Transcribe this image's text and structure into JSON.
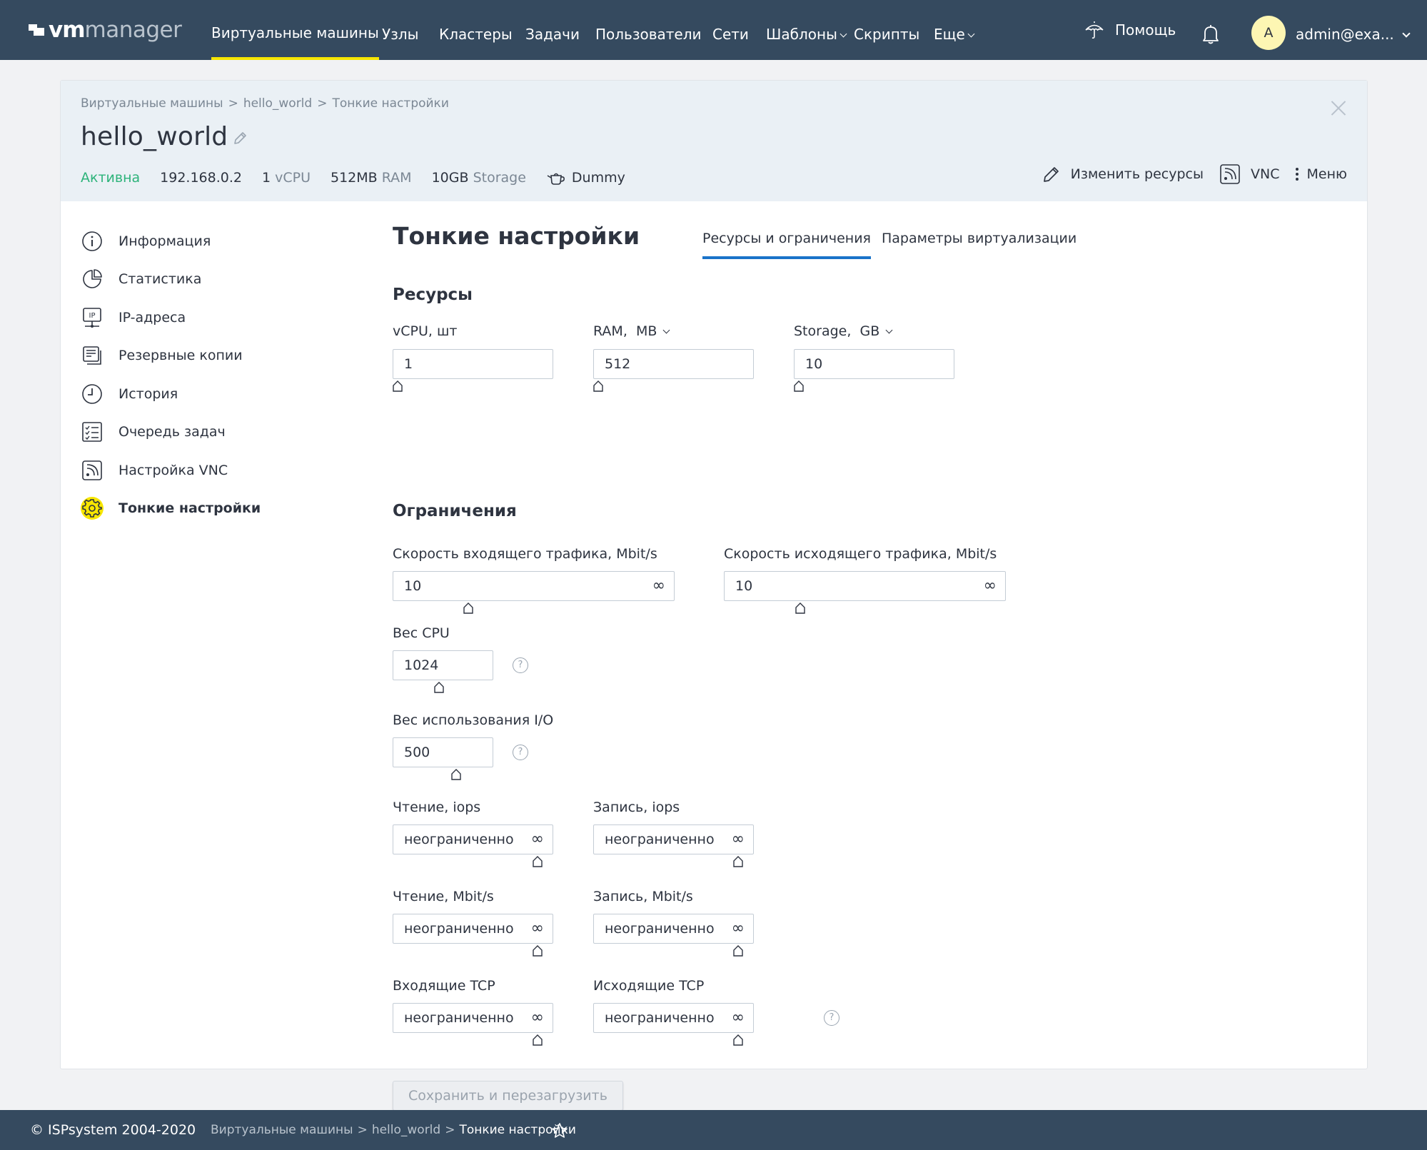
{
  "app": {
    "logo_bold": "vm",
    "logo_light": "manager"
  },
  "nav": {
    "items": [
      {
        "label": "Виртуальные машины",
        "active": true
      },
      {
        "label": "Узлы"
      },
      {
        "label": "Кластеры"
      },
      {
        "label": "Задачи"
      },
      {
        "label": "Пользователи"
      },
      {
        "label": "Сети"
      },
      {
        "label": "Шаблоны",
        "dropdown": true
      },
      {
        "label": "Скрипты"
      },
      {
        "label": "Еще",
        "dropdown": true
      }
    ],
    "help_label": "Помощь",
    "avatar_letter": "A",
    "user_label": "admin@exa..."
  },
  "header": {
    "breadcrumbs": [
      "Виртуальные машины",
      "hello_world",
      "Тонкие настройки"
    ],
    "breadcrumb_sep": ">",
    "vm_name": "hello_world",
    "status": "Активна",
    "ip": "192.168.0.2",
    "cpu_value": "1",
    "cpu_unit": "vCPU",
    "ram_value": "512MB",
    "ram_unit": "RAM",
    "storage_value": "10GB",
    "storage_unit": "Storage",
    "template": "Dummy",
    "actions": {
      "edit_resources": "Изменить ресурсы",
      "vnc": "VNC",
      "menu": "Меню"
    }
  },
  "sidebar": {
    "items": [
      {
        "label": "Информация",
        "icon": "info-icon"
      },
      {
        "label": "Статистика",
        "icon": "pie-chart-icon"
      },
      {
        "label": "IP-адреса",
        "icon": "ip-icon"
      },
      {
        "label": "Резервные копии",
        "icon": "backup-icon"
      },
      {
        "label": "История",
        "icon": "clock-icon"
      },
      {
        "label": "Очередь задач",
        "icon": "task-list-icon"
      },
      {
        "label": "Настройка VNC",
        "icon": "vnc-icon"
      },
      {
        "label": "Тонкие настройки",
        "icon": "gear-icon",
        "active": true
      }
    ]
  },
  "main": {
    "title": "Тонкие настройки",
    "tabs": [
      {
        "label": "Ресурсы и ограничения",
        "active": true
      },
      {
        "label": "Параметры виртуализации"
      }
    ],
    "resources": {
      "heading": "Ресурсы",
      "vcpu_label": "vCPU, шт",
      "vcpu_value": "1",
      "ram_label": "RAM,",
      "ram_unit": "MB",
      "ram_value": "512",
      "storage_label": "Storage,",
      "storage_unit": "GB",
      "storage_value": "10"
    },
    "limits": {
      "heading": "Ограничения",
      "in_traffic_label": "Скорость входящего трафика, Mbit/s",
      "in_traffic_value": "10",
      "out_traffic_label": "Скорость исходящего трафика, Mbit/s",
      "out_traffic_value": "10",
      "cpu_weight_label": "Вес CPU",
      "cpu_weight_value": "1024",
      "io_weight_label": "Вес использования I/O",
      "io_weight_value": "500",
      "read_iops_label": "Чтение, iops",
      "read_iops_value": "неограниченно",
      "write_iops_label": "Запись, iops",
      "write_iops_value": "неограниченно",
      "read_mbit_label": "Чтение, Mbit/s",
      "read_mbit_value": "неограниченно",
      "write_mbit_label": "Запись, Mbit/s",
      "write_mbit_value": "неограниченно",
      "in_tcp_label": "Входящие TCP",
      "in_tcp_value": "неограниченно",
      "out_tcp_label": "Исходящие TCP",
      "out_tcp_value": "неограниченно",
      "infinity_symbol": "∞",
      "help_symbol": "?"
    },
    "save_button": "Сохранить и перезагрузить"
  },
  "footer": {
    "copyright": "© ISPsystem 2004-2020",
    "breadcrumbs": [
      "Виртуальные машины",
      "hello_world",
      "Тонкие настройки"
    ]
  },
  "colors": {
    "topbar": "#354a5f",
    "accent_yellow": "#f7e600",
    "tab_underline": "#1a73c9",
    "status_green": "#2db37a"
  }
}
